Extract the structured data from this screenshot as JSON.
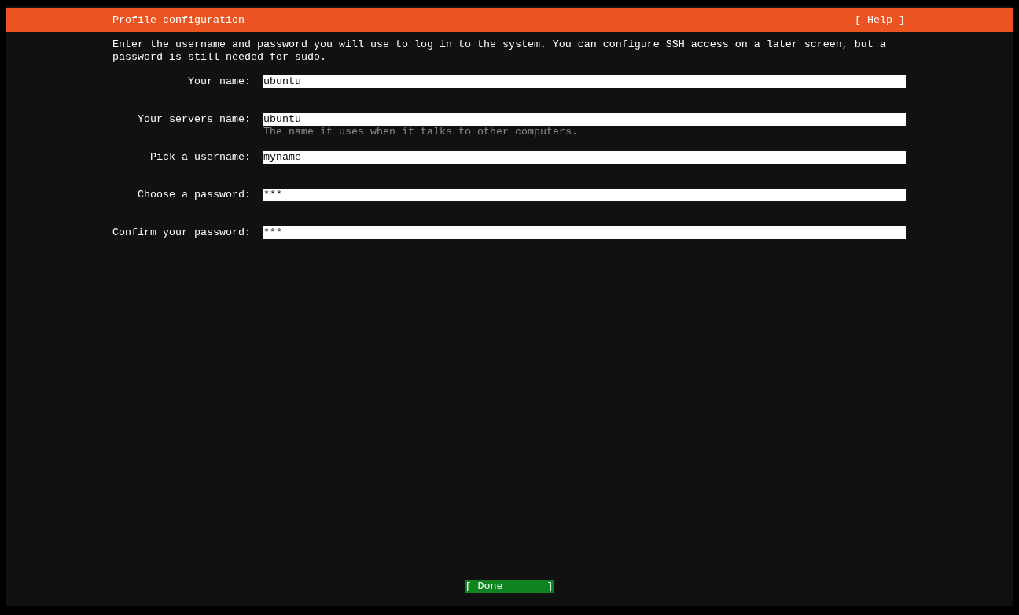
{
  "header": {
    "title": "Profile configuration",
    "help": "[ Help ]"
  },
  "intro": "Enter the username and password you will use to log in to the system. You can configure SSH access on a later screen, but a password is still needed for sudo.",
  "fields": [
    {
      "label": "Your name:",
      "value": "ubuntu"
    },
    {
      "label": "Your servers name:",
      "value": "ubuntu",
      "hint": "The name it uses when it talks to other computers."
    },
    {
      "label": "Pick a username:",
      "value": "myname"
    },
    {
      "label": "Choose a password:",
      "value": "***"
    },
    {
      "label": "Confirm your password:",
      "value": "***"
    }
  ],
  "done_button": "[ Done       ]"
}
